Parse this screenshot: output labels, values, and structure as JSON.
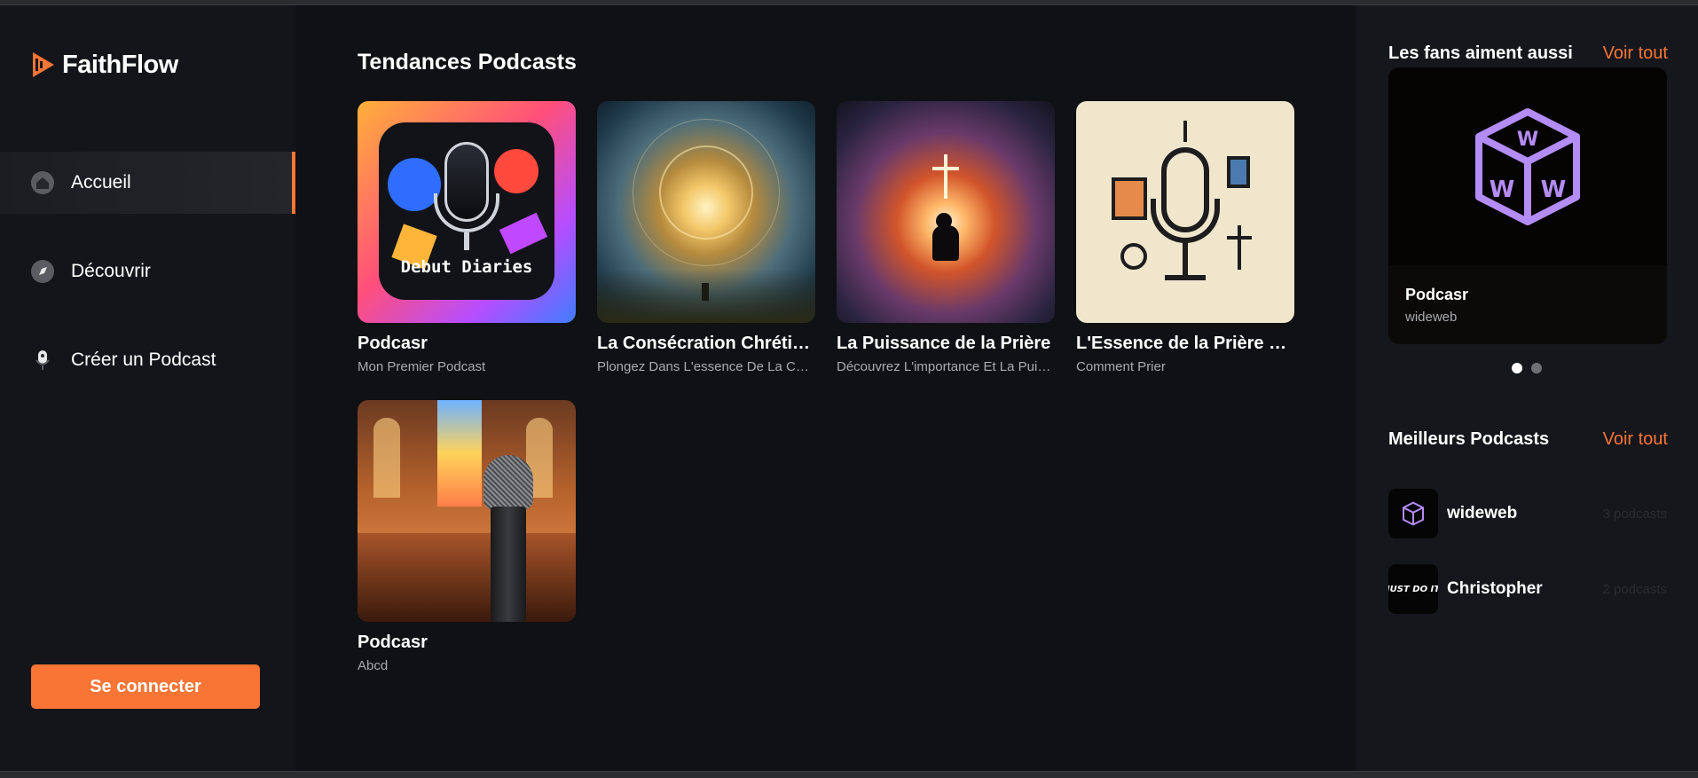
{
  "app": {
    "name": "FaithFlow"
  },
  "sidebar": {
    "items": [
      {
        "label": "Accueil",
        "icon": "home-icon"
      },
      {
        "label": "Découvrir",
        "icon": "compass-icon"
      },
      {
        "label": "Créer un Podcast",
        "icon": "microphone-icon"
      }
    ],
    "login_label": "Se connecter"
  },
  "main": {
    "section_title": "Tendances Podcasts",
    "podcasts": [
      {
        "title": "Podcasr",
        "subtitle": "Mon Premier Podcast",
        "cover_text": "Debut Diaries"
      },
      {
        "title": "La Consécration Chrétienne",
        "subtitle": "Plongez Dans L'essence De La Consécration"
      },
      {
        "title": "La Puissance de la Prière",
        "subtitle": "Découvrez L'importance Et La Puissance"
      },
      {
        "title": "L'Essence de la Prière Chrétienne",
        "subtitle": "Comment Prier"
      },
      {
        "title": "Podcasr",
        "subtitle": "Abcd"
      }
    ]
  },
  "right_panel": {
    "fans_title": "Les fans aiment aussi",
    "see_all": "Voir tout",
    "featured": {
      "name": "Podcasr",
      "author": "wideweb"
    },
    "best_title": "Meilleurs Podcasts",
    "best_see_all": "Voir tout",
    "top_podcasters": [
      {
        "name": "wideweb",
        "count": "3 podcasts"
      },
      {
        "name": "Christopher",
        "count": "2 podcasts",
        "avatar_text": "JUST DO IT"
      }
    ]
  },
  "colors": {
    "accent": "#f97535",
    "background": "#101114",
    "sidebar": "#13151a"
  }
}
